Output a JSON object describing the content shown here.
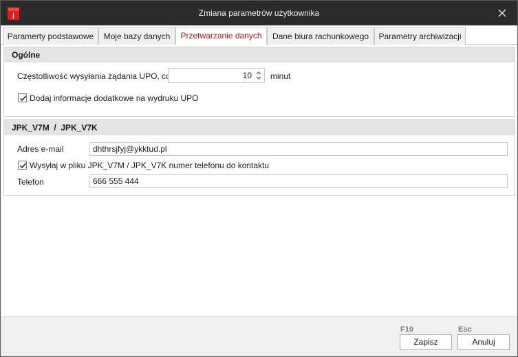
{
  "window": {
    "title": "Zmiana parametrów użytkownika",
    "app_icon": "app-logo-icon",
    "close_icon": "close-icon",
    "title_bar_color": "#2b2b2b"
  },
  "tabs": [
    {
      "label": "Paramerty podstawowe",
      "active": false
    },
    {
      "label": "Moje bazy danych",
      "active": false
    },
    {
      "label": "Przetwarzanie danych",
      "active": true
    },
    {
      "label": "Dane biura rachunkowego",
      "active": false
    },
    {
      "label": "Parametry archiwizacji",
      "active": false
    }
  ],
  "general": {
    "header": "Ogólne",
    "upo_label": "Częstotliwość wysyłania żądania UPO, co",
    "upo_value": "10",
    "upo_unit": "minut",
    "add_info_label": "Dodaj informacje dodatkowe na wydruku UPO",
    "add_info_checked": true
  },
  "jpk": {
    "header": "JPK_V7M  /  JPK_V7K",
    "email_label": "Adres e-mail",
    "email_value": "dhthrsjfyj@ykktud.pl",
    "send_phone_label": "Wysyłaj w pliku JPK_V7M / JPK_V7K numer telefonu do kontaktu",
    "send_phone_checked": true,
    "phone_label": "Telefon",
    "phone_value": "666 555 444"
  },
  "footer": {
    "save_shortcut": "F10",
    "save_label": "Zapisz",
    "cancel_shortcut": "Esc",
    "cancel_label": "Anuluj"
  },
  "colors": {
    "active_tab_text": "#a31616",
    "group_header_bg": "#e4e4e4",
    "footer_bg": "#f0f0f0"
  }
}
